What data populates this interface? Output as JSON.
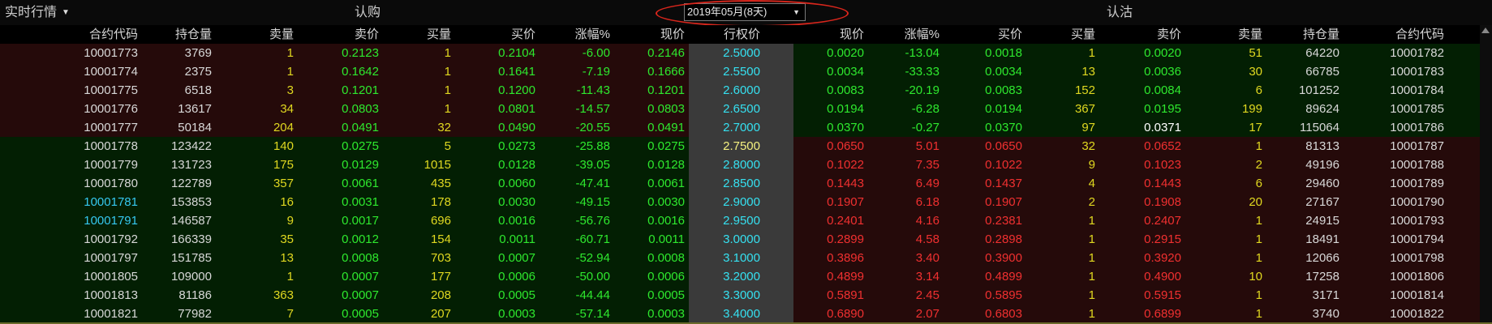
{
  "topbar": {
    "menu_label": "实时行情",
    "call_title": "认购",
    "put_title": "认沽",
    "date_selected": "2019年05月(8天)"
  },
  "headers": {
    "call": [
      "合约代码",
      "持仓量",
      "卖量",
      "卖价",
      "买量",
      "买价",
      "涨幅%",
      "现价"
    ],
    "strike": "行权价",
    "put": [
      "现价",
      "涨幅%",
      "买价",
      "买量",
      "卖价",
      "卖量",
      "持仓量",
      "合约代码"
    ]
  },
  "rows": [
    {
      "call": [
        "10001773",
        "3769",
        "1",
        "0.2123",
        "1",
        "0.2104",
        "-6.00",
        "0.2146"
      ],
      "strike": "2.5000",
      "put": [
        "0.0020",
        "-13.04",
        "0.0018",
        "1",
        "0.0020",
        "51",
        "64220",
        "10001782"
      ]
    },
    {
      "call": [
        "10001774",
        "2375",
        "1",
        "0.1642",
        "1",
        "0.1641",
        "-7.19",
        "0.1666"
      ],
      "strike": "2.5500",
      "put": [
        "0.0034",
        "-33.33",
        "0.0034",
        "13",
        "0.0036",
        "30",
        "66785",
        "10001783"
      ]
    },
    {
      "call": [
        "10001775",
        "6518",
        "3",
        "0.1201",
        "1",
        "0.1200",
        "-11.43",
        "0.1201"
      ],
      "strike": "2.6000",
      "put": [
        "0.0083",
        "-20.19",
        "0.0083",
        "152",
        "0.0084",
        "6",
        "101252",
        "10001784"
      ]
    },
    {
      "call": [
        "10001776",
        "13617",
        "34",
        "0.0803",
        "1",
        "0.0801",
        "-14.57",
        "0.0803"
      ],
      "strike": "2.6500",
      "put": [
        "0.0194",
        "-6.28",
        "0.0194",
        "367",
        "0.0195",
        "199",
        "89624",
        "10001785"
      ]
    },
    {
      "call": [
        "10001777",
        "50184",
        "204",
        "0.0491",
        "32",
        "0.0490",
        "-20.55",
        "0.0491"
      ],
      "strike": "2.7000",
      "put": [
        "0.0370",
        "-0.27",
        "0.0370",
        "97",
        "0.0371",
        "17",
        "115064",
        "10001786"
      ]
    },
    {
      "call": [
        "10001778",
        "123422",
        "140",
        "0.0275",
        "5",
        "0.0273",
        "-25.88",
        "0.0275"
      ],
      "strike": "2.7500",
      "put": [
        "0.0650",
        "5.01",
        "0.0650",
        "32",
        "0.0652",
        "1",
        "81313",
        "10001787"
      ]
    },
    {
      "call": [
        "10001779",
        "131723",
        "175",
        "0.0129",
        "1015",
        "0.0128",
        "-39.05",
        "0.0128"
      ],
      "strike": "2.8000",
      "put": [
        "0.1022",
        "7.35",
        "0.1022",
        "9",
        "0.1023",
        "2",
        "49196",
        "10001788"
      ]
    },
    {
      "call": [
        "10001780",
        "122789",
        "357",
        "0.0061",
        "435",
        "0.0060",
        "-47.41",
        "0.0061"
      ],
      "strike": "2.8500",
      "put": [
        "0.1443",
        "6.49",
        "0.1437",
        "4",
        "0.1443",
        "6",
        "29460",
        "10001789"
      ]
    },
    {
      "call": [
        "10001781",
        "153853",
        "16",
        "0.0031",
        "178",
        "0.0030",
        "-49.15",
        "0.0030"
      ],
      "strike": "2.9000",
      "put": [
        "0.1907",
        "6.18",
        "0.1907",
        "2",
        "0.1908",
        "20",
        "27167",
        "10001790"
      ]
    },
    {
      "call": [
        "10001791",
        "146587",
        "9",
        "0.0017",
        "696",
        "0.0016",
        "-56.76",
        "0.0016"
      ],
      "strike": "2.9500",
      "put": [
        "0.2401",
        "4.16",
        "0.2381",
        "1",
        "0.2407",
        "1",
        "24915",
        "10001793"
      ]
    },
    {
      "call": [
        "10001792",
        "166339",
        "35",
        "0.0012",
        "154",
        "0.0011",
        "-60.71",
        "0.0011"
      ],
      "strike": "3.0000",
      "put": [
        "0.2899",
        "4.58",
        "0.2898",
        "1",
        "0.2915",
        "1",
        "18491",
        "10001794"
      ]
    },
    {
      "call": [
        "10001797",
        "151785",
        "13",
        "0.0008",
        "703",
        "0.0007",
        "-52.94",
        "0.0008"
      ],
      "strike": "3.1000",
      "put": [
        "0.3896",
        "3.40",
        "0.3900",
        "1",
        "0.3920",
        "1",
        "12066",
        "10001798"
      ]
    },
    {
      "call": [
        "10001805",
        "109000",
        "1",
        "0.0007",
        "177",
        "0.0006",
        "-50.00",
        "0.0006"
      ],
      "strike": "3.2000",
      "put": [
        "0.4899",
        "3.14",
        "0.4899",
        "1",
        "0.4900",
        "10",
        "17258",
        "10001806"
      ]
    },
    {
      "call": [
        "10001813",
        "81186",
        "363",
        "0.0007",
        "208",
        "0.0005",
        "-44.44",
        "0.0005"
      ],
      "strike": "3.3000",
      "put": [
        "0.5891",
        "2.45",
        "0.5895",
        "1",
        "0.5915",
        "1",
        "3171",
        "10001814"
      ]
    },
    {
      "call": [
        "10001821",
        "77982",
        "7",
        "0.0005",
        "207",
        "0.0003",
        "-57.14",
        "0.0003"
      ],
      "strike": "3.4000",
      "put": [
        "0.6890",
        "2.07",
        "0.6803",
        "1",
        "0.6899",
        "1",
        "3740",
        "10001822"
      ]
    }
  ],
  "colors": {
    "call_itm_bg": "#250a0a",
    "call_otm_bg": "#031f03",
    "put_otm_bg": "#031f03",
    "put_itm_bg": "#250a0a",
    "strike_bg": "#3a3a3a",
    "strike_text": "#35e0f0",
    "strike_atm_text": "#f4f080",
    "code": "#d8d8d8",
    "code_cyan": "#35c8f0",
    "volume": "#e0d820",
    "down": "#2ee82e",
    "up": "#f03030",
    "white": "#ffffff"
  },
  "highlights": {
    "cyan_call_codes": [
      8,
      9
    ],
    "atm_strike_index": 5,
    "white_put_ask_index": 4
  }
}
